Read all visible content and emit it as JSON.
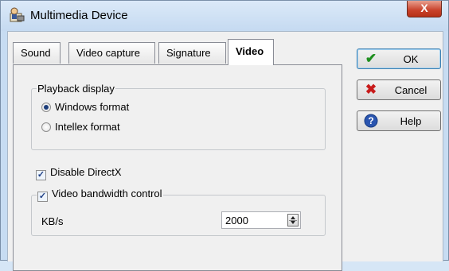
{
  "window": {
    "title": "Multimedia Device",
    "close_glyph": "X"
  },
  "tabs": [
    {
      "label": "Sound",
      "active": false
    },
    {
      "label": "Video capture",
      "active": false
    },
    {
      "label": "Signature",
      "active": false
    },
    {
      "label": "Video",
      "active": true
    }
  ],
  "playback": {
    "group_label": "Playback display",
    "options": [
      {
        "label": "Windows format",
        "selected": true
      },
      {
        "label": "Intellex format",
        "selected": false
      }
    ]
  },
  "disable_directx": {
    "label": "Disable DirectX",
    "checked": true
  },
  "bandwidth": {
    "group_label": "Video bandwidth control",
    "checked": true,
    "unit_label": "KB/s",
    "value": "2000"
  },
  "buttons": {
    "ok": {
      "label": "OK",
      "icon": "check-icon",
      "color": "#1f8f1f"
    },
    "cancel": {
      "label": "Cancel",
      "icon": "x-icon",
      "color": "#c81b1b"
    },
    "help": {
      "label": "Help",
      "icon": "help-icon",
      "color": "#2a55b0"
    }
  }
}
